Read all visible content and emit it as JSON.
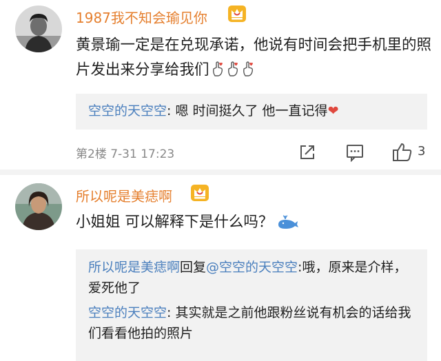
{
  "comments": [
    {
      "username": "1987我不知会瑜见你",
      "text": "黄景瑜一定是在兑现承诺，他说有时间会把手机里的照片发出来分享给我们",
      "emoji": [
        "hand-heart-icon",
        "hand-heart-icon",
        "hand-heart-icon"
      ],
      "replies": [
        {
          "name": "空空的天空空",
          "sep": ": ",
          "text": "嗯 时间挺久了 他一直记得",
          "emoji": "❤"
        }
      ],
      "floor": "第2楼",
      "time": "7-31 17:23",
      "like_count": "3"
    },
    {
      "username": "所以呢是美痣啊",
      "text": "小姐姐  可以解释下是什么吗？",
      "emoji": [
        "whale-icon"
      ],
      "replies": [
        {
          "name": "所以呢是美痣啊",
          "mid": "回复",
          "mention": "@空空的天空空",
          "sep": ":",
          "text": "哦，原来是介样，爱死他了"
        },
        {
          "name": "空空的天空空",
          "sep": ": ",
          "text": "其实就是之前他跟粉丝说有机会的话给我们看看他拍的照片"
        }
      ]
    }
  ],
  "colors": {
    "username": "#e57f2e",
    "reply_name": "#4a7fbd",
    "reply_bg": "#f2f2f2",
    "heart": "#e0483e",
    "crown": "#f5b324"
  }
}
